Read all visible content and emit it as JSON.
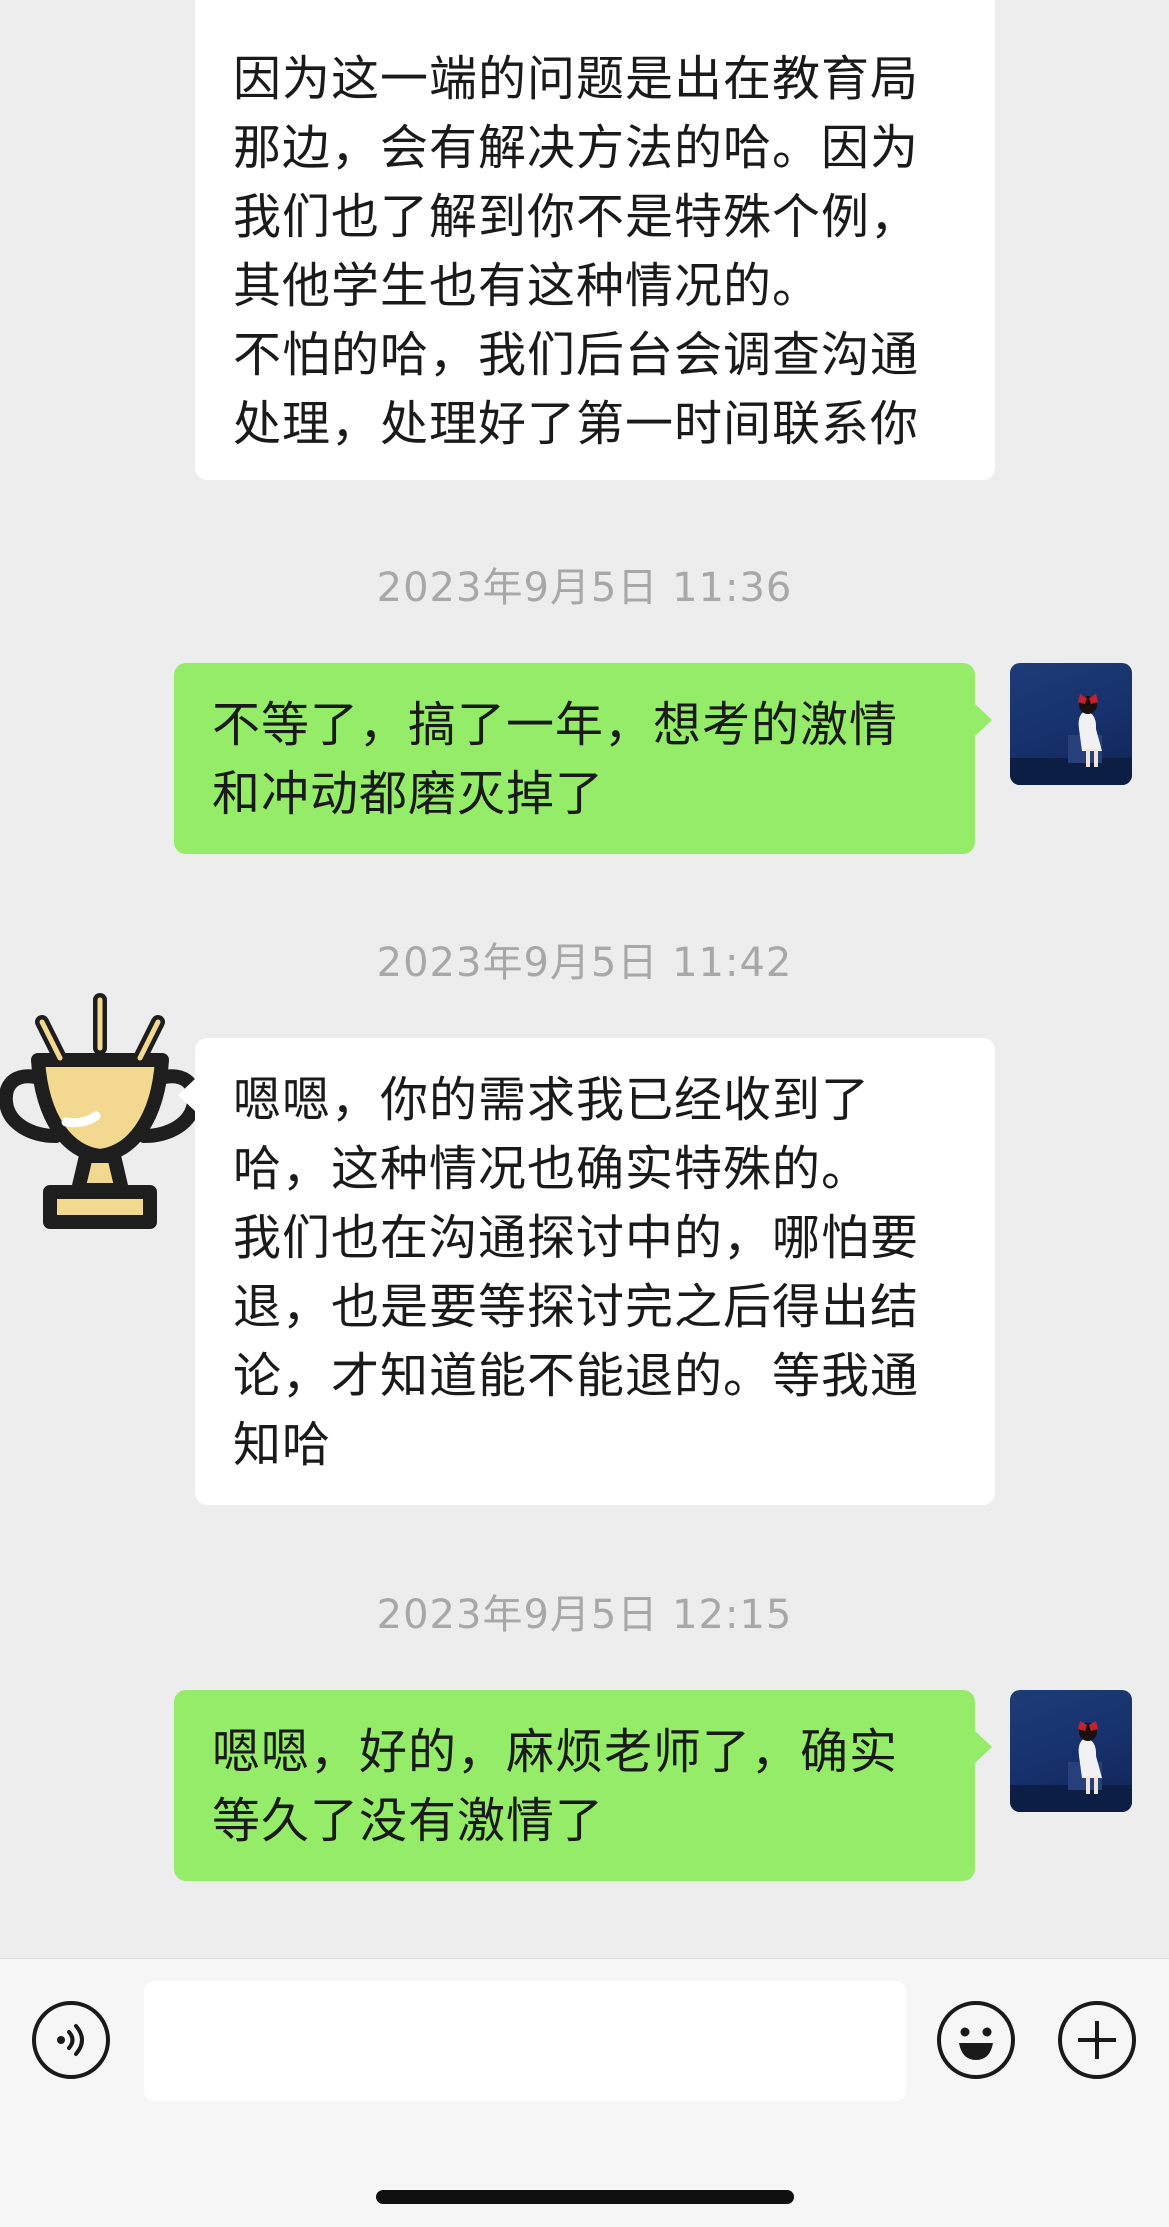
{
  "conversation": {
    "messages": [
      {
        "id": "m1",
        "sender": "agent",
        "text": "因为这一端的问题是出在教育局\n那边，会有解决方法的哈。因为\n我们也了解到你不是特殊个例，\n其他学生也有这种情况的。\n不怕的哈，我们后台会调查沟通\n处理，处理好了第一时间联系你"
      },
      {
        "id": "t1",
        "timestamp": "2023年9月5日 11:36"
      },
      {
        "id": "m2",
        "sender": "user",
        "text": "不等了，搞了一年，想考的激情\n和冲动都磨灭掉了"
      },
      {
        "id": "t2",
        "timestamp": "2023年9月5日 11:42"
      },
      {
        "id": "m3",
        "sender": "agent",
        "text": "嗯嗯，你的需求我已经收到了\n哈，这种情况也确实特殊的。\n我们也在沟通探讨中的，哪怕要\n退，也是要等探讨完之后得出结\n论，才知道能不能退的。等我通\n知哈"
      },
      {
        "id": "t3",
        "timestamp": "2023年9月5日 12:15"
      },
      {
        "id": "m4",
        "sender": "user",
        "text": "嗯嗯，好的，麻烦老师了，确实\n等久了没有激情了"
      }
    ]
  },
  "avatars": {
    "user_icon": "girl-on-blue-background",
    "agent_icon": "trophy-icon"
  },
  "input_bar": {
    "voice_icon": "voice-icon",
    "emoji_icon": "emoji-icon",
    "plus_icon": "plus-icon",
    "text_value": ""
  },
  "colors": {
    "background": "#ededed",
    "outgoing_bubble": "#95ec69",
    "incoming_bubble": "#ffffff",
    "timestamp": "#a8a8a8",
    "trophy_fill": "#f3d98f",
    "trophy_outline": "#1e1e1e"
  }
}
